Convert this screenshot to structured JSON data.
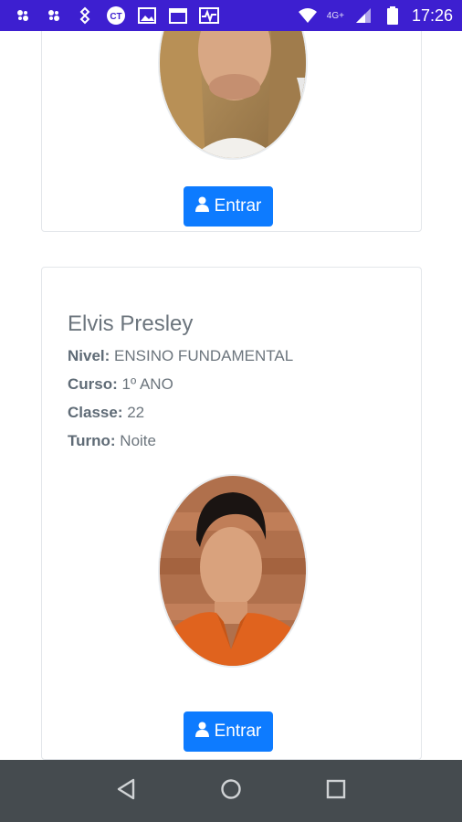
{
  "status_bar": {
    "time": "17:26",
    "network": "4G+",
    "icons": [
      "app-icon",
      "app-icon",
      "sync-icon",
      "ct-icon",
      "gallery-icon",
      "calendar-icon",
      "pulse-icon",
      "wifi-icon",
      "signal-icon",
      "battery-icon"
    ]
  },
  "cards": [
    {
      "button_label": "Entrar",
      "button_icon": "user-icon"
    },
    {
      "name": "Elvis Presley",
      "nivel_label": "Nivel:",
      "nivel_value": "ENSINO FUNDAMENTAL",
      "curso_label": "Curso:",
      "curso_value": "1º ANO",
      "classe_label": "Classe:",
      "classe_value": "22",
      "turno_label": "Turno:",
      "turno_value": "Noite",
      "button_label": "Entrar",
      "button_icon": "user-icon"
    }
  ],
  "nav_bar": {
    "buttons": [
      "back-icon",
      "home-icon",
      "recents-icon"
    ]
  },
  "colors": {
    "status_bar": "#3d1fd0",
    "button": "#0d7bff",
    "nav_bar": "#454b4f",
    "text_muted": "#6c757d"
  }
}
